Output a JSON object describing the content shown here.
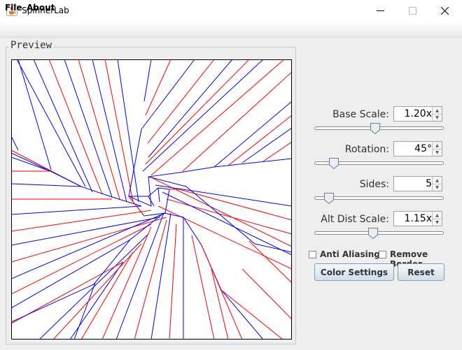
{
  "window": {
    "title": "SpinnerLab",
    "controls": {
      "minimize_icon": "minimize-icon",
      "maximize_icon": "maximize-icon",
      "close_icon": "close-icon"
    }
  },
  "menu": {
    "items": [
      {
        "label": "File"
      },
      {
        "label": "About"
      }
    ]
  },
  "preview": {
    "title": "Preview",
    "colors": {
      "a": "#0000ff",
      "b": "#ff0000",
      "border": "#000000"
    }
  },
  "controls": {
    "base_scale": {
      "label": "Base Scale:",
      "value": "1.20x",
      "slider_fraction": 0.47
    },
    "rotation": {
      "label": "Rotation:",
      "value": "45°",
      "slider_fraction": 0.12
    },
    "sides": {
      "label": "Sides:",
      "value": "5",
      "slider_fraction": 0.08
    },
    "alt_dist_scale": {
      "label": "Alt Dist Scale:",
      "value": "1.15x",
      "slider_fraction": 0.45
    }
  },
  "options": {
    "anti_aliasing": {
      "label": "Anti Aliasing",
      "checked": false
    },
    "remove_border": {
      "label": "Remove Border",
      "checked": false
    }
  },
  "buttons": {
    "color_settings": "Color Settings",
    "reset": "Reset"
  }
}
